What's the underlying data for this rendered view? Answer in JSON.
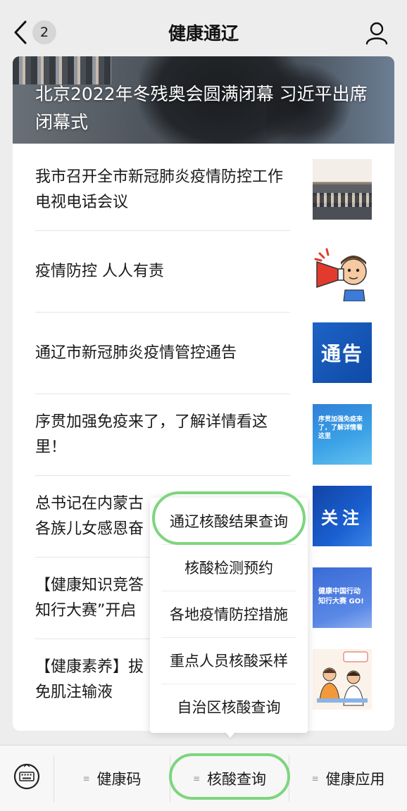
{
  "header": {
    "back_count": "2",
    "title": "健康通辽"
  },
  "hero": {
    "title": "北京2022年冬残奥会圆满闭幕 习近平出席闭幕式"
  },
  "news": [
    {
      "title": "我市召开全市新冠肺炎疫情防控工作电视电话会议",
      "thumb": "meeting-photo"
    },
    {
      "title": "疫情防控 人人有责",
      "thumb": "megaphone-cartoon"
    },
    {
      "title": "通辽市新冠肺炎疫情管控通告",
      "thumb_text": "通告"
    },
    {
      "title": "序贯加强免疫来了，了解详情看这里！",
      "thumb_text": "序贯加强免疫来了，了解详情看这里"
    },
    {
      "title": "总书记在内蒙古",
      "title_line2": "各族儿女感恩奋",
      "thumb_text": "关注"
    },
    {
      "title": "【健康知识竞答",
      "title_line2": "知行大赛”开启",
      "thumb_text": "健康中国行动 知行大赛 GO!"
    },
    {
      "title": "【健康素养】拔",
      "title_line2": "免肌注输液",
      "thumb": "doctor-illustration"
    }
  ],
  "popup_menu": {
    "items": [
      "通辽核酸结果查询",
      "核酸检测预约",
      "各地疫情防控措施",
      "重点人员核酸采样",
      "自治区核酸查询"
    ],
    "highlighted_index": 0
  },
  "bottom_tabs": [
    {
      "label": "健康码"
    },
    {
      "label": "核酸查询",
      "highlighted": true
    },
    {
      "label": "健康应用"
    }
  ],
  "colors": {
    "highlight_ring": "#7dd57e",
    "background": "#ededed",
    "notice_blue": "#1d63c6"
  },
  "icons": {
    "back": "chevron-left-icon",
    "profile": "user-icon",
    "keyboard": "keyboard-icon",
    "menu": "menu-lines-icon"
  }
}
